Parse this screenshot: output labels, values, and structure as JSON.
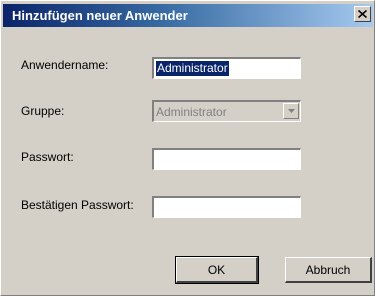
{
  "window": {
    "title": "Hinzufügen neuer Anwender",
    "close_symbol": "X"
  },
  "form": {
    "username_label": "Anwendername:",
    "username_value": "Administrator",
    "group_label": "Gruppe:",
    "group_value": "Administrator",
    "password_label": "Passwort:",
    "password_value": "",
    "confirm_label": "Bestätigen Passwort:",
    "confirm_value": ""
  },
  "buttons": {
    "ok_label": "OK",
    "cancel_label": "Abbruch"
  },
  "colors": {
    "title_start": "#0a246a",
    "title_end": "#a6caf0",
    "face": "#d4d0c8",
    "selection": "#0a246a"
  },
  "icons": {
    "close": "close-icon",
    "dropdown": "chevron-down-icon"
  }
}
